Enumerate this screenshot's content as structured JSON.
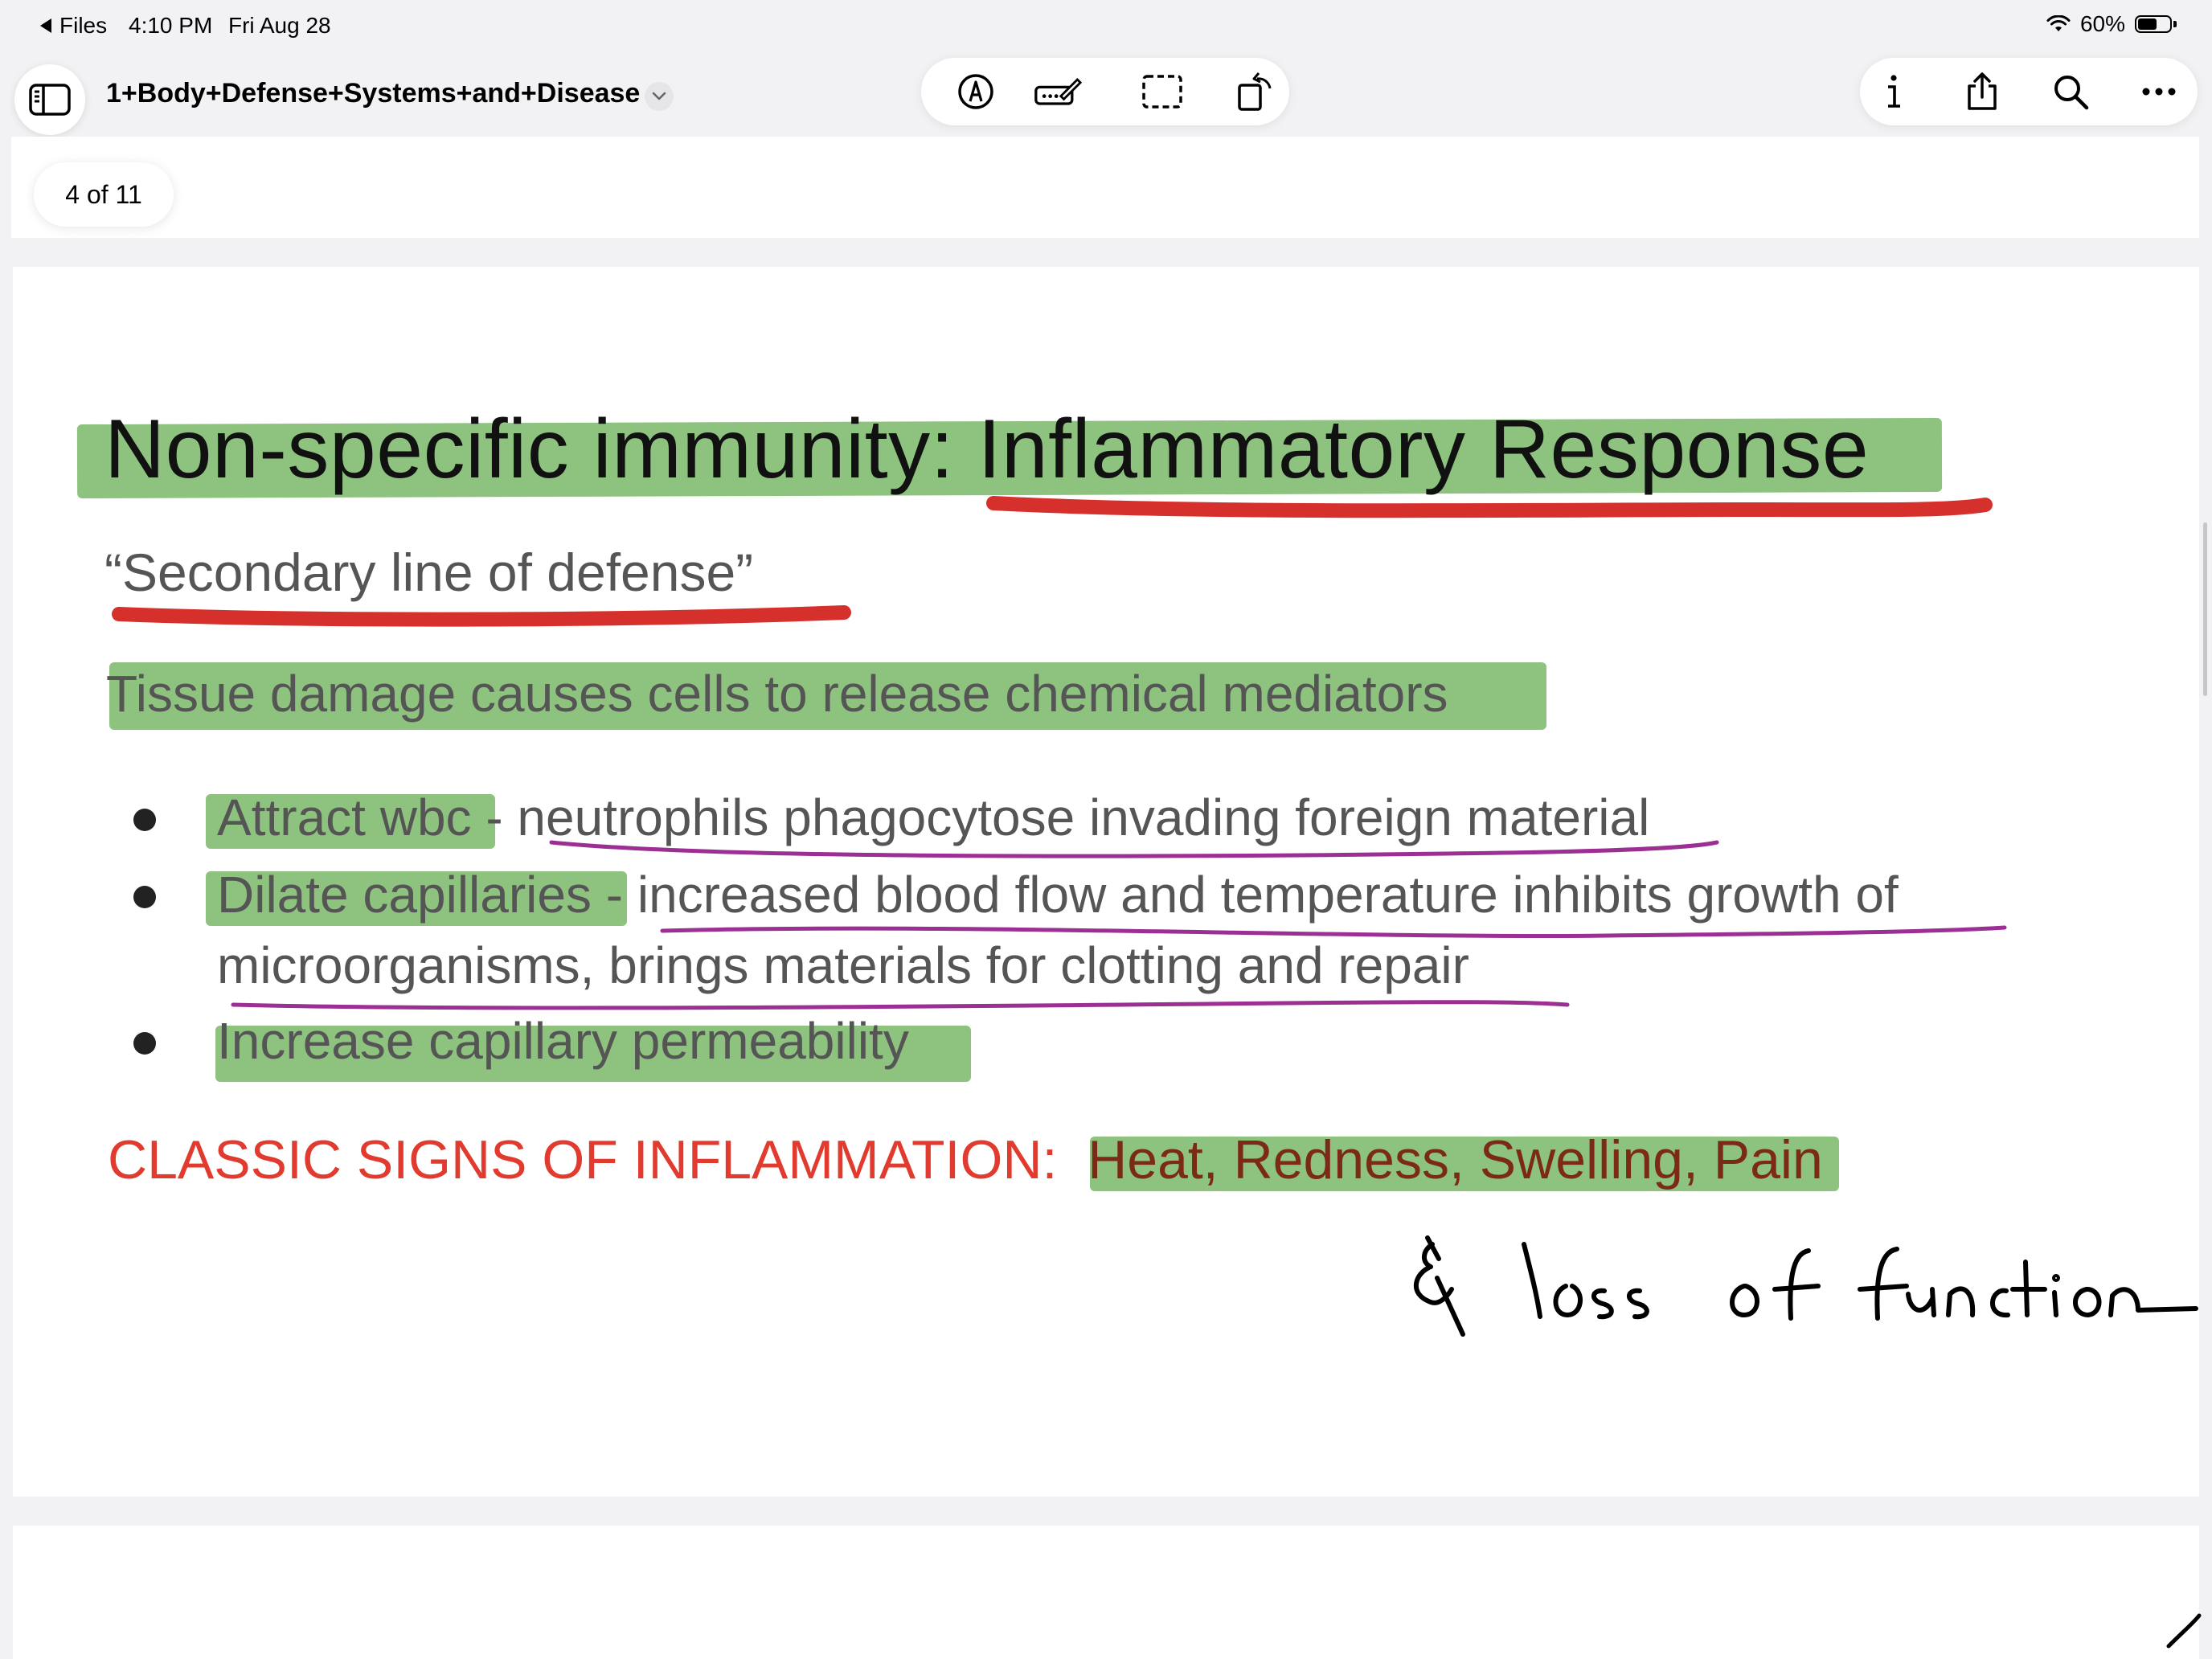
{
  "status_bar": {
    "back_label": "Files",
    "time": "4:10 PM",
    "date": "Fri Aug 28",
    "battery": "60%",
    "battery_level": 0.6
  },
  "toolbar": {
    "document_title": "1+Body+Defense+Systems+and+Disease",
    "icons": {
      "sidebar": "sidebar-icon",
      "title_menu": "chevron-down-icon",
      "markup": "markup-pen-icon",
      "text_box": "text-box-pen-icon",
      "selection": "selection-rect-icon",
      "rotate": "rotate-page-icon",
      "info": "info-icon",
      "share": "share-icon",
      "search": "search-icon",
      "more": "more-ellipsis-icon"
    }
  },
  "page_indicator": "4 of 11",
  "slide": {
    "title": "Non-specific immunity: Inflammatory Response",
    "subtitle": "“Secondary line of defense”",
    "line": "Tissue damage causes cells to release chemical mediators",
    "bullets": [
      {
        "lead": "Attract wbc",
        "rest": " - neutrophils phagocytose invading foreign material"
      },
      {
        "lead": "Dilate capillaries",
        "rest": " - increased blood flow and temperature inhibits growth of",
        "continuation": "microorganisms, brings materials for clotting and repair"
      },
      {
        "lead": "Increase capillary permeability",
        "rest": ""
      }
    ],
    "signs_label": "CLASSIC SIGNS OF INFLAMMATION:",
    "signs_values": "Heat, Redness, Swelling, Pain"
  },
  "annotations": {
    "handwritten": "& loss of function",
    "highlight_color": "#8ec27f",
    "underline_red": "#d6302c",
    "underline_purple": "#9b2f93",
    "ink_color": "#000000"
  }
}
